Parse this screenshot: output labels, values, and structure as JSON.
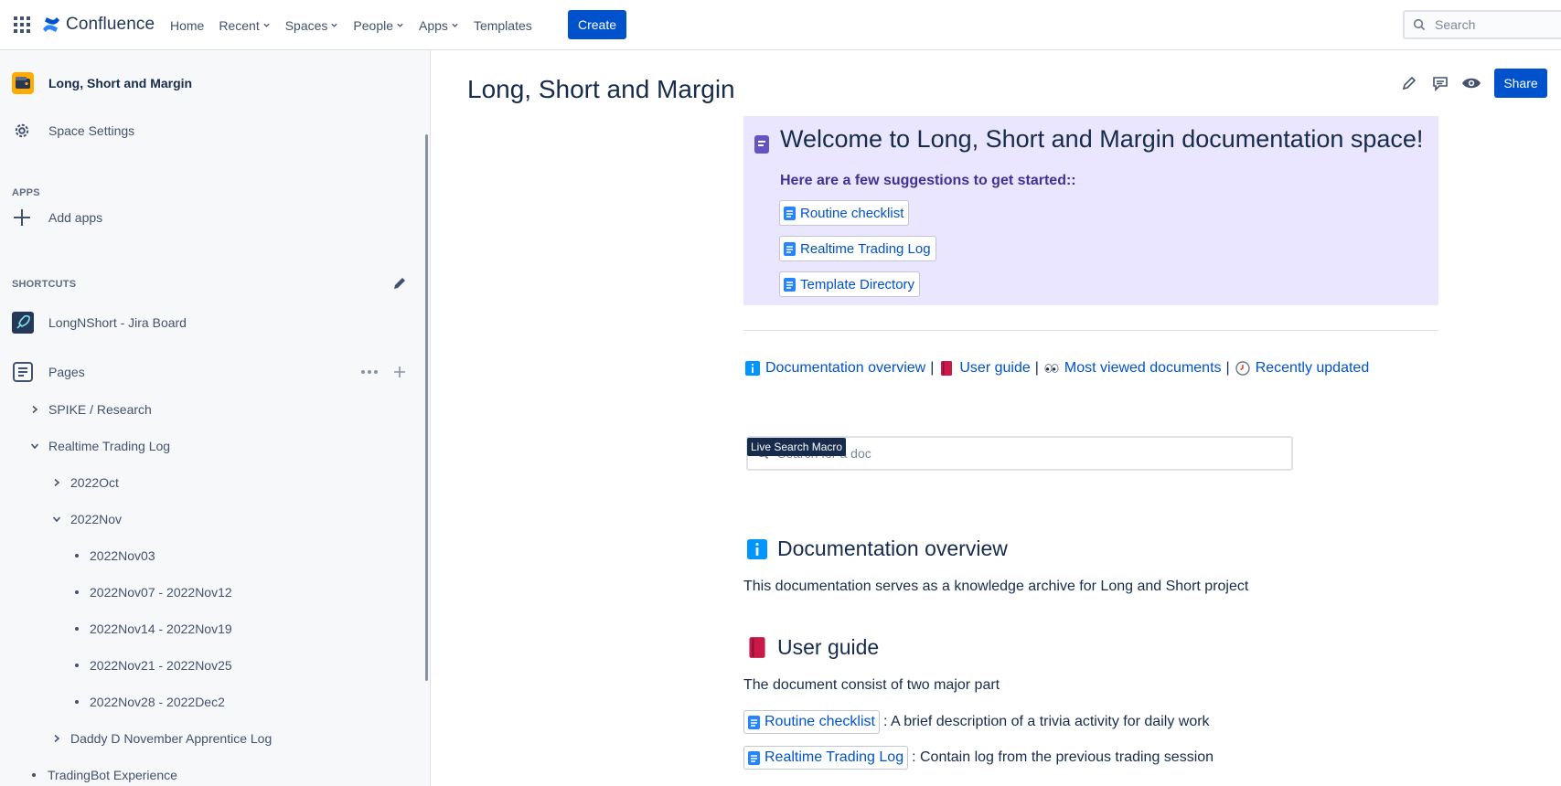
{
  "app": {
    "name": "Confluence"
  },
  "nav": {
    "items": [
      {
        "label": "Home",
        "dropdown": false
      },
      {
        "label": "Recent",
        "dropdown": true
      },
      {
        "label": "Spaces",
        "dropdown": true
      },
      {
        "label": "People",
        "dropdown": true
      },
      {
        "label": "Apps",
        "dropdown": true
      },
      {
        "label": "Templates",
        "dropdown": false
      }
    ],
    "create_label": "Create",
    "search_placeholder": "Search"
  },
  "sidebar": {
    "space_title": "Long, Short and Margin",
    "space_settings": "Space Settings",
    "apps_header": "APPS",
    "add_apps": "Add apps",
    "shortcuts_header": "SHORTCUTS",
    "shortcut_jira": "LongNShort - Jira Board",
    "pages_label": "Pages",
    "tree": [
      {
        "label": "SPIKE / Research"
      },
      {
        "label": "Realtime Trading Log"
      },
      {
        "label": "2022Oct"
      },
      {
        "label": "2022Nov"
      },
      {
        "label": "2022Nov03"
      },
      {
        "label": "2022Nov07 - 2022Nov12"
      },
      {
        "label": "2022Nov14 - 2022Nov19"
      },
      {
        "label": "2022Nov21 - 2022Nov25"
      },
      {
        "label": "2022Nov28 - 2022Dec2"
      },
      {
        "label": "Daddy D November Apprentice Log"
      },
      {
        "label": "TradingBot Experience"
      }
    ]
  },
  "main": {
    "title": "Long, Short and Margin",
    "share_label": "Share",
    "welcome": {
      "title": "Welcome to Long, Short and Margin documentation space!",
      "subtitle": "Here are a few suggestions to get started::",
      "links": [
        "Routine checklist",
        "Realtime Trading Log",
        "Template Directory"
      ]
    },
    "quick_links": {
      "l1": "Documentation overview",
      "l2": "User guide",
      "l3": "Most viewed documents",
      "l4": "Recently updated",
      "sep": "|"
    },
    "live_search": {
      "placeholder": "Search for a doc",
      "tooltip": "Live Search Macro"
    },
    "doc_overview": {
      "heading": "Documentation overview",
      "text": "This documentation serves as a knowledge archive for Long and Short project"
    },
    "user_guide": {
      "heading": "User guide",
      "text": "The document consist of two major part",
      "item1_link": "Routine checklist",
      "item1_text": ": A brief description of a trivia activity for daily work",
      "item2_link": "Realtime Trading Log",
      "item2_text": ": Contain log from the previous trading session"
    }
  },
  "colors": {
    "primary": "#0052cc",
    "text": "#172b4d",
    "welcome_bg": "#eae6ff",
    "welcome_sub": "#403294"
  }
}
